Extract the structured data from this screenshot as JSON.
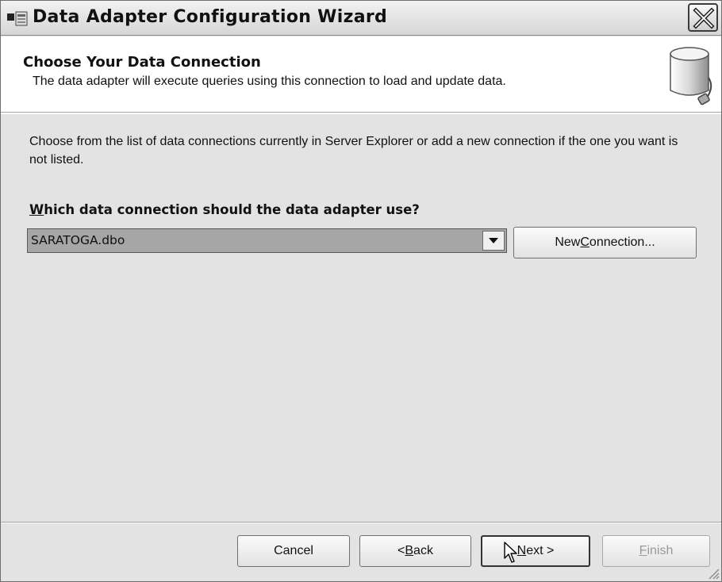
{
  "window": {
    "title": "Data Adapter Configuration Wizard",
    "icon": "wizard-app-icon"
  },
  "header": {
    "title": "Choose Your Data Connection",
    "subtitle": "The data adapter will execute queries using this connection to load and update data.",
    "icon": "database-icon"
  },
  "body": {
    "instructions": "Choose from the list of data connections currently in Server Explorer or add a new connection if the one you want is not listed.",
    "question_accel": "W",
    "question_rest": "hich data connection should the data adapter use?",
    "connection_value": "SARATOGA.dbo",
    "new_connection": {
      "pre": "New ",
      "accel": "C",
      "post": "onnection..."
    }
  },
  "footer": {
    "cancel": "Cancel",
    "back": {
      "pre": "< ",
      "accel": "B",
      "post": "ack"
    },
    "next": {
      "pre": "",
      "accel": "N",
      "post": "ext >"
    },
    "finish": {
      "pre": "",
      "accel": "F",
      "post": "inish"
    }
  },
  "colors": {
    "window_bg": "#e3e3e3",
    "header_bg": "#ffffff",
    "combo_selected_bg": "#a6a6a6"
  }
}
